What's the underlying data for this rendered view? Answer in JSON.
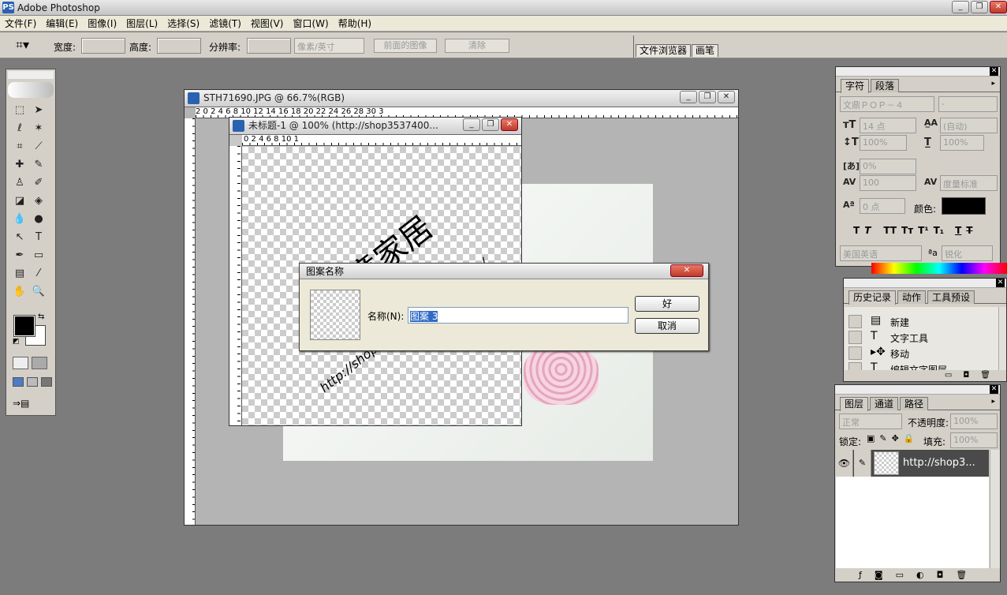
{
  "app": {
    "title": "Adobe Photoshop",
    "logo": "PS"
  },
  "window_controls": {
    "minimize": "_",
    "restore": "❐",
    "close": "✕"
  },
  "menu": [
    "文件(F)",
    "编辑(E)",
    "图像(I)",
    "图层(L)",
    "选择(S)",
    "滤镜(T)",
    "视图(V)",
    "窗口(W)",
    "帮助(H)"
  ],
  "options": {
    "width_label": "宽度:",
    "height_label": "高度:",
    "resolution_label": "分辨率:",
    "unit_select": "像素/英寸",
    "front_image_btn": "前面的图像",
    "clear_btn": "清除"
  },
  "palette_well": {
    "tabs": [
      "文件浏览器",
      "画笔"
    ]
  },
  "doc_main": {
    "title": "STH71690.JPG @ 66.7%(RGB)",
    "ruler_h": "2  0  2  4  6  8  10  12  14  16  18  20  22  24  26  28  30  3"
  },
  "doc_small": {
    "title": "未标题-1 @ 100% (http://shop3537400...",
    "ruler_h": "0     2     4     6     8     10    1",
    "canvas_text_big": "创意家居",
    "canvas_text_url": "http://shop3537400.taobao.com/"
  },
  "dialog": {
    "title": "图案名称",
    "name_label": "名称(N):",
    "name_value": "图案 3",
    "ok": "好",
    "cancel": "取消"
  },
  "char_panel": {
    "tabs": [
      "字符",
      "段落"
    ],
    "font": "文鼎ＰＯＰ－４",
    "style": "-",
    "size": "14 点",
    "leading": "(自动)",
    "vscale": "100%",
    "hscale": "100%",
    "tracking_pct": "0%",
    "kerning": "100",
    "tracking_label": "度量标准",
    "baseline": "0 点",
    "color_label": "颜色:",
    "color": "#000000",
    "language": "美国英语",
    "aa_label": "ªa",
    "antialias": "锐化",
    "styles": [
      "T",
      "T",
      "TT",
      "Tт",
      "T¹",
      "T₁",
      "T",
      "T"
    ]
  },
  "history_panel": {
    "tabs": [
      "历史记录",
      "动作",
      "工具预设"
    ],
    "items": [
      {
        "icon": "▤",
        "label": "新建"
      },
      {
        "icon": "T",
        "label": "文字工具"
      },
      {
        "icon": "▸✥",
        "label": "移动"
      },
      {
        "icon": "T",
        "label": "编辑文字图层"
      }
    ]
  },
  "layers_panel": {
    "tabs": [
      "图层",
      "通道",
      "路径"
    ],
    "blend": "正常",
    "opacity_label": "不透明度:",
    "opacity": "100%",
    "lock_label": "锁定:",
    "fill_label": "填充:",
    "fill": "100%",
    "layer_name": "http://shop3..."
  }
}
